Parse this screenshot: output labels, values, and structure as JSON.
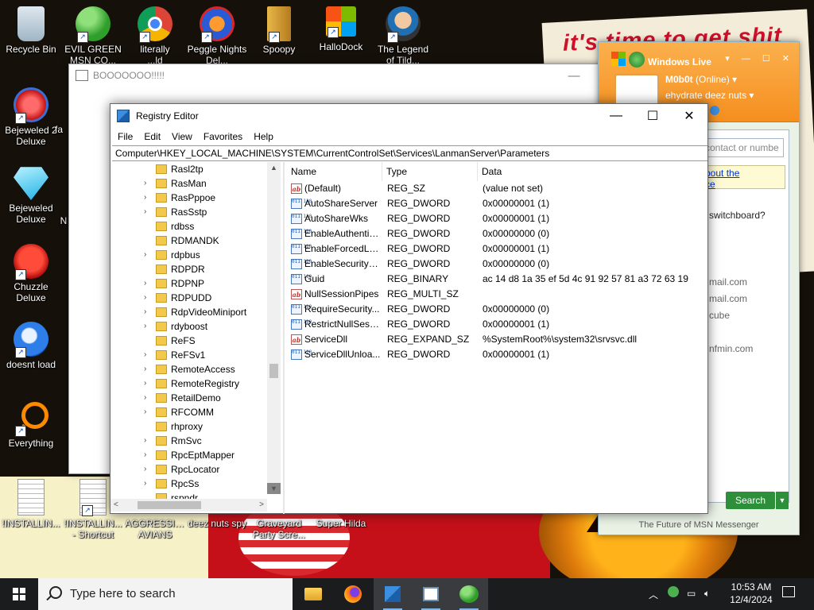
{
  "desktop_icons": [
    {
      "name": "recycle-bin",
      "label1": "Recycle Bin",
      "label2": ""
    },
    {
      "name": "evil-green-msn",
      "label1": "EVIL GREEN",
      "label2": "MSN CO..."
    },
    {
      "name": "literally",
      "label1": "literally",
      "label2": "...ld"
    },
    {
      "name": "peggle-nights",
      "label1": "Peggle Nights",
      "label2": "Del..."
    },
    {
      "name": "spoopy",
      "label1": "Spoopy",
      "label2": ""
    },
    {
      "name": "hallodock",
      "label1": "HalloDock",
      "label2": ""
    },
    {
      "name": "the-legend",
      "label1": "The Legend",
      "label2": "of Tild..."
    },
    {
      "name": "bejeweled-2-deluxe",
      "label1": "Bejeweled 2",
      "label2": "Deluxe"
    },
    {
      "name": "bejeweled-deluxe",
      "label1": "Bejeweled",
      "label2": "Deluxe"
    },
    {
      "name": "chuzzle-deluxe",
      "label1": "Chuzzle",
      "label2": "Deluxe"
    },
    {
      "name": "doesnt-load",
      "label1": "doesnt load",
      "label2": ""
    },
    {
      "name": "everything",
      "label1": "Everything",
      "label2": ""
    },
    {
      "name": "installing",
      "label1": "!INSTALLIN...",
      "label2": ""
    },
    {
      "name": "installing-shortcut",
      "label1": "!INSTALLIN...",
      "label2": "- Shortcut"
    },
    {
      "name": "aggressive-avians",
      "label1": "AGGRESSIVE",
      "label2": "AVIANS"
    },
    {
      "name": "deez-nuts-spy",
      "label1": "deez nuts spy",
      "label2": ""
    },
    {
      "name": "graveyard-party",
      "label1": "Graveyard",
      "label2": "Party Scre..."
    },
    {
      "name": "super-hilda",
      "label1": "Super Hilda",
      "label2": ""
    }
  ],
  "desktop_partial": {
    "fa": "fa",
    "n": "N"
  },
  "wallpaper_text": "it's time to get shit",
  "bg_window": {
    "title": "BOOOOOOO!!!!!",
    "min": "—",
    "max": "☐",
    "close": "✕"
  },
  "msn": {
    "title": "Windows Live",
    "user": "M0b0t",
    "online": "(Online)",
    "status": "ehydrate deez nuts",
    "search_placeholder": "contact or numbe",
    "ad_line1": "bout the",
    "ad_line2": "ce",
    "line_switchboard": "switchboard?",
    "line_mail1": "mail.com",
    "line_mail2": "mail.com",
    "line_cube": "cube",
    "line_nfmin": "nfmin.com",
    "search_button": "Search",
    "footer": "The Future of MSN Messenger"
  },
  "registry": {
    "title": "Registry Editor",
    "min": "—",
    "max": "☐",
    "close": "✕",
    "menu": [
      "File",
      "Edit",
      "View",
      "Favorites",
      "Help"
    ],
    "address": "Computer\\HKEY_LOCAL_MACHINE\\SYSTEM\\CurrentControlSet\\Services\\LanmanServer\\Parameters",
    "tree": [
      {
        "label": "Rasl2tp",
        "expandable": false
      },
      {
        "label": "RasMan",
        "expandable": true
      },
      {
        "label": "RasPppoe",
        "expandable": true
      },
      {
        "label": "RasSstp",
        "expandable": true
      },
      {
        "label": "rdbss",
        "expandable": false
      },
      {
        "label": "RDMANDK",
        "expandable": false
      },
      {
        "label": "rdpbus",
        "expandable": true
      },
      {
        "label": "RDPDR",
        "expandable": false
      },
      {
        "label": "RDPNP",
        "expandable": true
      },
      {
        "label": "RDPUDD",
        "expandable": true
      },
      {
        "label": "RdpVideoMiniport",
        "expandable": true
      },
      {
        "label": "rdyboost",
        "expandable": true
      },
      {
        "label": "ReFS",
        "expandable": false
      },
      {
        "label": "ReFSv1",
        "expandable": true
      },
      {
        "label": "RemoteAccess",
        "expandable": true
      },
      {
        "label": "RemoteRegistry",
        "expandable": true
      },
      {
        "label": "RetailDemo",
        "expandable": true
      },
      {
        "label": "RFCOMM",
        "expandable": true
      },
      {
        "label": "rhproxy",
        "expandable": false
      },
      {
        "label": "RmSvc",
        "expandable": true
      },
      {
        "label": "RpcEptMapper",
        "expandable": true
      },
      {
        "label": "RpcLocator",
        "expandable": true
      },
      {
        "label": "RpcSs",
        "expandable": true
      },
      {
        "label": "rspndr",
        "expandable": false
      }
    ],
    "columns": [
      "Name",
      "Type",
      "Data"
    ],
    "values": [
      {
        "name": "(Default)",
        "type": "REG_SZ",
        "data": "(value not set)",
        "icon": "sz"
      },
      {
        "name": "AutoShareServer",
        "type": "REG_DWORD",
        "data": "0x00000001 (1)",
        "icon": "bin"
      },
      {
        "name": "AutoShareWks",
        "type": "REG_DWORD",
        "data": "0x00000001 (1)",
        "icon": "bin"
      },
      {
        "name": "EnableAuthentic...",
        "type": "REG_DWORD",
        "data": "0x00000000 (0)",
        "icon": "bin"
      },
      {
        "name": "EnableForcedLo...",
        "type": "REG_DWORD",
        "data": "0x00000001 (1)",
        "icon": "bin"
      },
      {
        "name": "EnableSecuritySi...",
        "type": "REG_DWORD",
        "data": "0x00000000 (0)",
        "icon": "bin"
      },
      {
        "name": "Guid",
        "type": "REG_BINARY",
        "data": "ac 14 d8 1a 35 ef 5d 4c 91 92 57 81 a3 72 63 19",
        "icon": "bin"
      },
      {
        "name": "NullSessionPipes",
        "type": "REG_MULTI_SZ",
        "data": "",
        "icon": "sz"
      },
      {
        "name": "RequireSecurity...",
        "type": "REG_DWORD",
        "data": "0x00000000 (0)",
        "icon": "bin"
      },
      {
        "name": "RestrictNullSess...",
        "type": "REG_DWORD",
        "data": "0x00000001 (1)",
        "icon": "bin"
      },
      {
        "name": "ServiceDll",
        "type": "REG_EXPAND_SZ",
        "data": "%SystemRoot%\\system32\\srvsvc.dll",
        "icon": "sz"
      },
      {
        "name": "ServiceDllUnloa...",
        "type": "REG_DWORD",
        "data": "0x00000001 (1)",
        "icon": "bin"
      }
    ]
  },
  "taskbar": {
    "search_placeholder": "Type here to search",
    "time": "10:53 AM",
    "date": "12/4/2024"
  },
  "colors": {
    "taskbar": "#1b1c1e",
    "msn_orange": "#f58f1f",
    "folder": "#f3c94b",
    "accent": "#0078d7"
  }
}
